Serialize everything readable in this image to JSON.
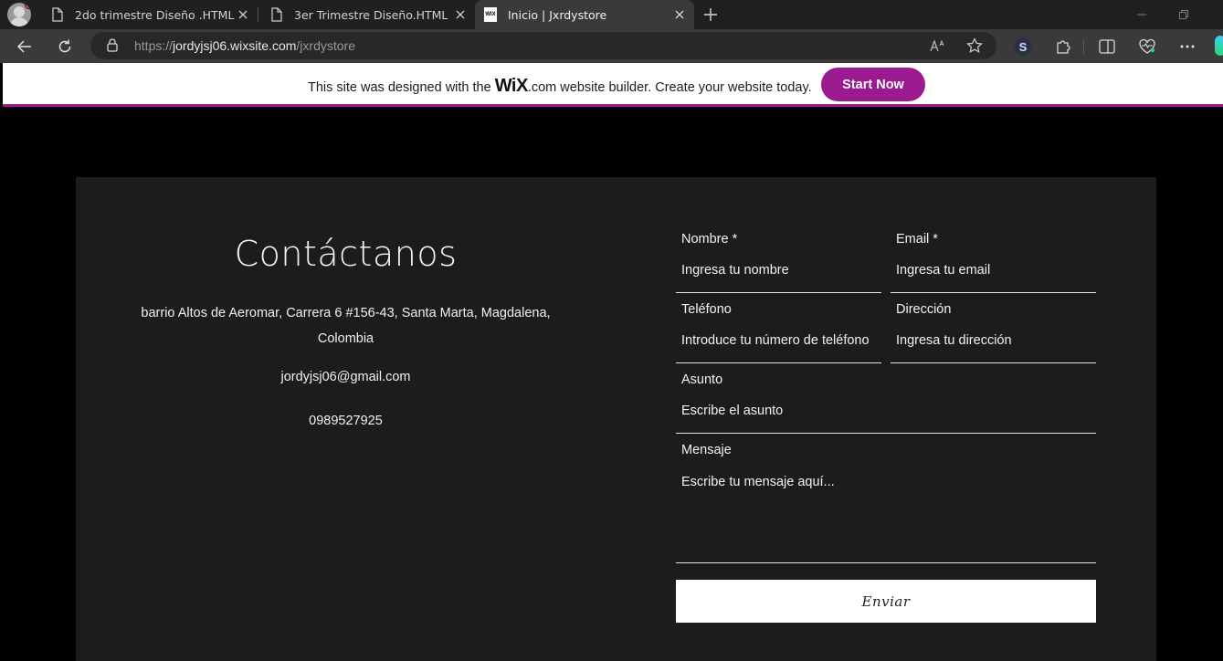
{
  "browser": {
    "tabs": [
      {
        "title": "2do trimestre Diseño .HTML",
        "icon": "page-icon",
        "active": false
      },
      {
        "title": "3er Trimestre Diseño.HTML",
        "icon": "page-icon",
        "active": false
      },
      {
        "title": "Inicio | Jxrdystore",
        "icon": "wix-favicon",
        "active": true
      }
    ],
    "wix_favicon_text": "WIX",
    "url_prefix": "https://",
    "url_host": "jordyjsj06.wixsite.com",
    "url_path": "/jxrdystore",
    "extension_label": "S"
  },
  "wix_banner": {
    "text_before": "This site was designed with the ",
    "logo": "WiX",
    "text_after": ".com website builder. Create your website today.",
    "button_label": "Start Now",
    "accent_color": "#9b1a8f"
  },
  "contact": {
    "title": "Contáctanos",
    "address": "barrio Altos de Aeromar, Carrera 6 #156-43, Santa Marta, Magdalena, Colombia",
    "email": "jordyjsj06@gmail.com",
    "phone": "0989527925"
  },
  "form": {
    "name_label": "Nombre *",
    "name_placeholder": "Ingresa tu nombre",
    "email_label": "Email *",
    "email_placeholder": "Ingresa tu email",
    "phone_label": "Teléfono",
    "phone_placeholder": "Introduce tu número de teléfono",
    "address_label": "Dirección",
    "address_placeholder": "Ingresa tu dirección",
    "subject_label": "Asunto",
    "subject_placeholder": "Escribe el asunto",
    "message_label": "Mensaje",
    "message_placeholder": "Escribe tu mensaje aquí...",
    "submit_label": "Enviar"
  }
}
